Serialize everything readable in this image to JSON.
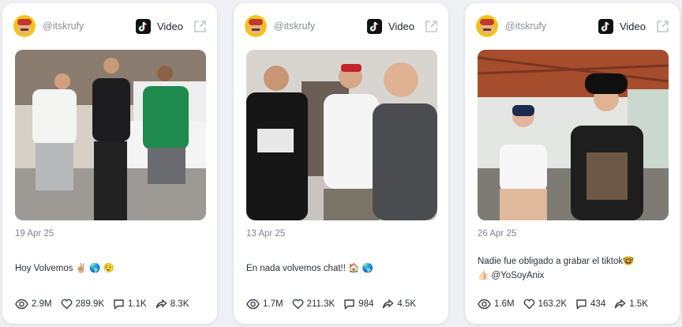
{
  "cards": [
    {
      "handle": "@itskrufy",
      "video_label": "Video",
      "date": "19 Apr 25",
      "caption_lines": [
        "Hoy Volvemos ✌🏼 🌎 😮‍💨"
      ],
      "stats": {
        "views": "2.9M",
        "likes": "289.9K",
        "comments": "1.1K",
        "shares": "8.3K"
      }
    },
    {
      "handle": "@itskrufy",
      "video_label": "Video",
      "date": "13 Apr 25",
      "caption_lines": [
        "En nada volvemos chat!! 🏠 🌎"
      ],
      "stats": {
        "views": "1.7M",
        "likes": "211.3K",
        "comments": "984",
        "shares": "4.5K"
      }
    },
    {
      "handle": "@itskrufy",
      "video_label": "Video",
      "date": "26 Apr 25",
      "caption_lines": [
        "Nadie fue obligado a grabar el tiktok🤓",
        "👍🏻 @YoSoyAnix"
      ],
      "stats": {
        "views": "1.6M",
        "likes": "163.2K",
        "comments": "434",
        "shares": "1.5K"
      }
    }
  ],
  "icons": [
    "eye-icon",
    "heart-icon",
    "comment-icon",
    "share-icon",
    "tiktok-icon",
    "external-link-icon"
  ],
  "colors": {
    "card_bg": "#ffffff",
    "page_bg": "#eef0f3",
    "muted_text": "#8a8f99",
    "text": "#2a2f3a"
  }
}
